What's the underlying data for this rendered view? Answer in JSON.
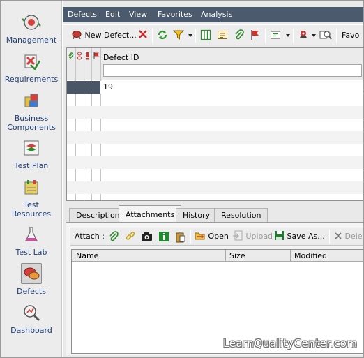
{
  "sidebar": {
    "items": [
      {
        "label_line1": "Management",
        "label_line2": "",
        "icon": "management-icon"
      },
      {
        "label_line1": "Requirements",
        "label_line2": "",
        "icon": "requirements-icon"
      },
      {
        "label_line1": "Business",
        "label_line2": "Components",
        "icon": "business-components-icon"
      },
      {
        "label_line1": "Test Plan",
        "label_line2": "",
        "icon": "test-plan-icon"
      },
      {
        "label_line1": "Test",
        "label_line2": "Resources",
        "icon": "test-resources-icon"
      },
      {
        "label_line1": "Test Lab",
        "label_line2": "",
        "icon": "test-lab-icon"
      },
      {
        "label_line1": "Defects",
        "label_line2": "",
        "icon": "defects-icon"
      },
      {
        "label_line1": "Dashboard",
        "label_line2": "",
        "icon": "dashboard-icon"
      }
    ],
    "active": "Defects"
  },
  "menubar": {
    "items": [
      "Defects",
      "Edit",
      "View",
      "Favorites",
      "Analysis"
    ]
  },
  "toolbar": {
    "new_defect_label": "New Defect...",
    "favorites_label": "Favo"
  },
  "grid": {
    "column_header": "Defect ID",
    "filter_value": "",
    "rows": [
      {
        "defect_id": "19"
      }
    ]
  },
  "tabs": {
    "items": [
      "Description",
      "Attachments",
      "History",
      "Resolution"
    ],
    "active": "Attachments"
  },
  "attachments": {
    "attach_label": "Attach :",
    "open_label": "Open",
    "upload_label": "Upload",
    "save_as_label": "Save As...",
    "delete_label": "Dele",
    "columns": [
      "Name",
      "Size",
      "Modified"
    ]
  },
  "watermark": "LearnQualityCenter.com",
  "colors": {
    "menubar_bg": "#4b5a6c",
    "selected_row": "#4a5665",
    "sidebar_text": "#1e3f7a"
  }
}
